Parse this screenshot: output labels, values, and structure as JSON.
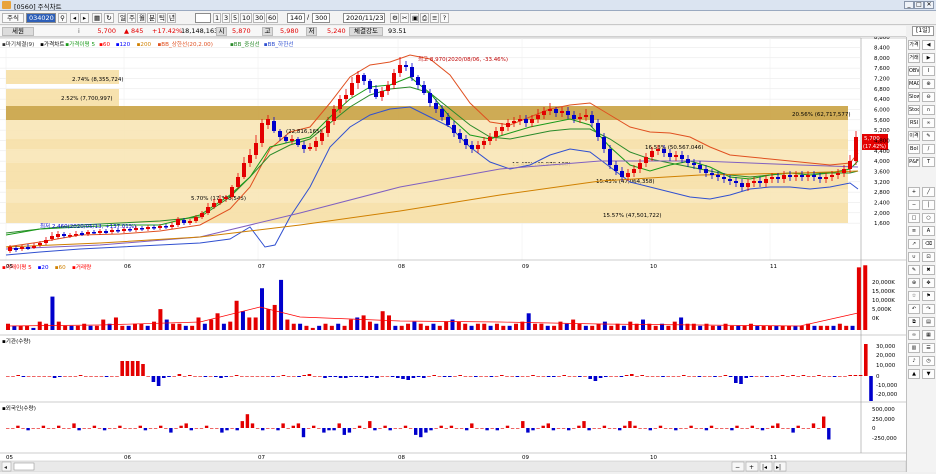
{
  "window": {
    "title": "[0560] 주식차트",
    "close_glyph": "✕",
    "max_glyph": "□",
    "min_glyph": "_"
  },
  "toolbar": {
    "market": "주식",
    "code": "034020",
    "period_buttons": [
      "주",
      "월",
      "분",
      "틱",
      "년"
    ],
    "interval_buttons": [
      "1",
      "3",
      "5",
      "10",
      "30",
      "60"
    ],
    "count": "140",
    "max_count": "300",
    "date": "2020/11/23"
  },
  "quote": {
    "name": "세원",
    "price": "5,700",
    "change": "845",
    "change_pct": "+17.42%",
    "volume": "18,148,163",
    "open_label": "시",
    "open": "5,870",
    "high_label": "고",
    "high": "5,980",
    "low_label": "저",
    "low": "5,240",
    "strength_label": "체결강도",
    "strength": "93.51"
  },
  "oneday": "[1일]",
  "colors": {
    "up": "#e30000",
    "down": "#0000cc",
    "band_fill": "#f6dfa5",
    "band_dark": "#b8912e",
    "ma5": "#1a9a1a",
    "ma20": "#e05020",
    "bb_mid": "#2a8a2a"
  },
  "price_panel": {
    "legend": [
      {
        "text": "마기체결(9)",
        "color": "#333333"
      },
      {
        "text": "가격차트",
        "color": "#000000"
      },
      {
        "text": "가격이평 5",
        "color": "#1a9a1a"
      },
      {
        "text": "60",
        "color": "#ff0000"
      },
      {
        "text": "120",
        "color": "#0000ff"
      },
      {
        "text": "200",
        "color": "#d08000"
      },
      {
        "text": "BB_상한선(20,2.00)",
        "color": "#e05020"
      },
      {
        "text": "BB_중심선",
        "color": "#2a8a2a"
      },
      {
        "text": "BB_하한선",
        "color": "#3050d0"
      }
    ],
    "y_ticks": [
      "8,800",
      "8,400",
      "8,000",
      "7,600",
      "7,200",
      "6,800",
      "6,400",
      "6,000",
      "5,600",
      "5,200",
      "4,800",
      "4,400",
      "4,000",
      "3,600",
      "3,200",
      "2,800",
      "2,400",
      "2,000",
      "1,600"
    ],
    "price_tag": "5,700",
    "price_tag_pct": "(17.42%)",
    "bands": [
      {
        "label": "2.74% (8,355,724)"
      },
      {
        "label": "2.52% (7,700,997)"
      },
      {
        "label": "20.56% (62,717,577)"
      },
      {
        "label": ""
      },
      {
        "label": "16.53% (50,567,046)"
      },
      {
        "label": "13.43% (40,970,168)"
      },
      {
        "label": "15.43% (47,064,358)"
      },
      {
        "label": "5.70% (17,398,545)"
      },
      {
        "label": "15.57% (47,501,722)"
      }
    ],
    "annotations": {
      "high": "최고 8,970(2020/08/06, -33.46%)",
      "low": "최저 2,460(2020/05/13, +137.01%)",
      "mid": "(22,816,165)"
    }
  },
  "volume_panel": {
    "legend": [
      {
        "text": "거래이평 5",
        "color": "#ff0000"
      },
      {
        "text": "20",
        "color": "#0000ff"
      },
      {
        "text": "60",
        "color": "#d08000"
      },
      {
        "text": "거래량",
        "color": "#ff0000"
      }
    ],
    "y_ticks": [
      "20,000K",
      "15,000K",
      "10,000K",
      "5,000K",
      "0K"
    ]
  },
  "inst_panel": {
    "legend": "기관(수량)",
    "y_ticks": [
      "30,000",
      "20,000",
      "10,000",
      "0",
      "-10,000",
      "-20,000"
    ]
  },
  "foreign_panel": {
    "legend": "외국인(수량)",
    "y_ticks": [
      "500,000",
      "250,000",
      "0",
      "-250,000"
    ]
  },
  "x_ticks": [
    "05",
    "06",
    "07",
    "08",
    "09",
    "10",
    "11"
  ],
  "side_buttons": [
    {
      "a": "가격이평",
      "b": "◀"
    },
    {
      "a": "거래이평",
      "b": "▶"
    },
    {
      "a": "OBV",
      "b": "I"
    },
    {
      "a": "MACD",
      "b": "⊕"
    },
    {
      "a": "Slow%K",
      "b": "⊖"
    },
    {
      "a": "Stoc",
      "b": "∩"
    },
    {
      "a": "RSI",
      "b": "∞"
    },
    {
      "a": "이격도",
      "b": "✎"
    },
    {
      "a": "Bol Band",
      "b": "/"
    },
    {
      "a": "P&F",
      "b": "T"
    }
  ]
}
